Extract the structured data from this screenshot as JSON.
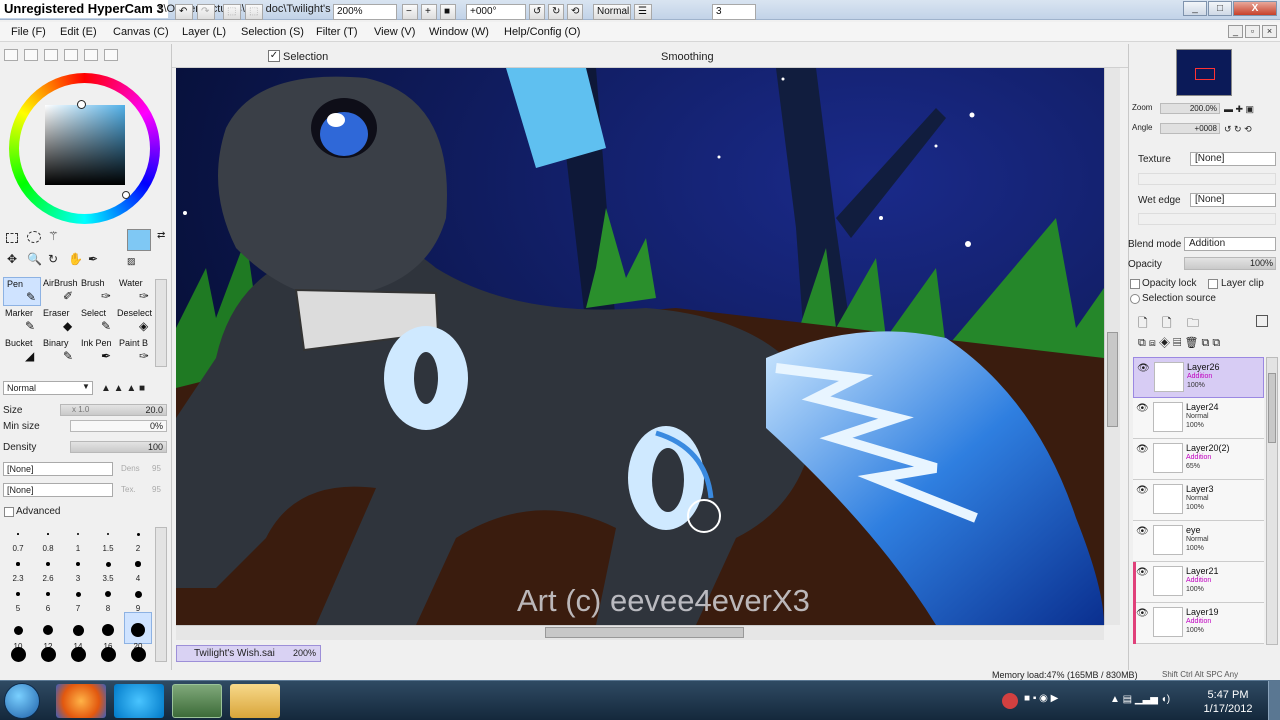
{
  "title_bar": {
    "recorder_label": "Unregistered HyperCam 3",
    "window_title": "s\\Owner\\Pictures\\SAI doc\\Twilight's Wish.sai (*)",
    "min_label": "_",
    "max_label": "□",
    "close_label": "X"
  },
  "menu": {
    "items": [
      "File (F)",
      "Edit (E)",
      "Canvas (C)",
      "Layer (L)",
      "Selection (S)",
      "Filter (T)",
      "View (V)",
      "Window (W)",
      "Help/Config (O)"
    ]
  },
  "toolbar": {
    "selection_label": "Selection",
    "zoom_value": "200%",
    "rotation_value": "+000°",
    "blend_value": "Normal",
    "smoothing_label": "Smoothing",
    "smoothing_value": "3"
  },
  "tools": {
    "cells": [
      {
        "label": "Pen"
      },
      {
        "label": "AirBrush"
      },
      {
        "label": "Brush"
      },
      {
        "label": "Water"
      },
      {
        "label": "Marker"
      },
      {
        "label": "Eraser"
      },
      {
        "label": "Select"
      },
      {
        "label": "Deselect"
      },
      {
        "label": "Bucket"
      },
      {
        "label": "Binary"
      },
      {
        "label": "Ink Pen"
      },
      {
        "label": "Paint B"
      }
    ]
  },
  "brush": {
    "mode": "Normal",
    "size_label": "Size",
    "size_multiplier": "x 1.0",
    "size_value": "20.0",
    "min_size_label": "Min size",
    "min_size_value": "0%",
    "density_label": "Density",
    "density_value": "100",
    "paper_texture": "[None]",
    "paper_texture_value": "Dens",
    "paper_texture_number": "95",
    "brush_shape": "[None]",
    "brush_shape_value": "Tex.",
    "brush_shape_number": "95",
    "advanced_label": "Advanced",
    "sizes": [
      "0.7",
      "0.8",
      "1",
      "1.5",
      "2",
      "2.3",
      "2.6",
      "3",
      "3.5",
      "4",
      "5",
      "6",
      "7",
      "8",
      "9",
      "10",
      "12",
      "14",
      "16",
      "20"
    ]
  },
  "document": {
    "tab_name": "Twilight's Wish.sai",
    "tab_zoom": "200%",
    "watermark": "Art (c) eevee4everX3"
  },
  "status": {
    "memory": "Memory load:47% (165MB / 830MB)",
    "keys": [
      "Shift",
      "Ctrl",
      "Alt",
      "SPC",
      "Any"
    ]
  },
  "navigator": {
    "zoom_label": "Zoom",
    "zoom_value": "200.0%",
    "angle_label": "Angle",
    "angle_value": "+0008"
  },
  "layer_props": {
    "texture_label": "Texture",
    "texture_value": "[None]",
    "wet_edge_label": "Wet edge",
    "wet_edge_value": "[None]",
    "blend_label": "Blend mode",
    "blend_value": "Addition",
    "opacity_label": "Opacity",
    "opacity_value": "100%",
    "opacity_lock_label": "Opacity lock",
    "layer_clip_label": "Layer clip",
    "selection_source_label": "Selection source"
  },
  "layers": [
    {
      "name": "Layer26",
      "mode": "Addition",
      "opacity": "100%",
      "selected": true,
      "clip": false
    },
    {
      "name": "Layer24",
      "mode": "Normal",
      "opacity": "100%",
      "selected": false,
      "clip": false
    },
    {
      "name": "Layer20(2)",
      "mode": "Addition",
      "opacity": "65%",
      "selected": false,
      "clip": false
    },
    {
      "name": "Layer3",
      "mode": "Normal",
      "opacity": "100%",
      "selected": false,
      "clip": false
    },
    {
      "name": "eye",
      "mode": "Normal",
      "opacity": "100%",
      "selected": false,
      "clip": false
    },
    {
      "name": "Layer21",
      "mode": "Addition",
      "opacity": "100%",
      "selected": false,
      "clip": true
    },
    {
      "name": "Layer19",
      "mode": "Addition",
      "opacity": "100%",
      "selected": false,
      "clip": true
    }
  ],
  "taskbar": {
    "time": "5:47 PM",
    "date": "1/17/2012"
  },
  "colors": {
    "accent_primary": "#7fc8f4",
    "layer_selected": "#d7ccf4",
    "blend_addition": "#c000c0"
  }
}
